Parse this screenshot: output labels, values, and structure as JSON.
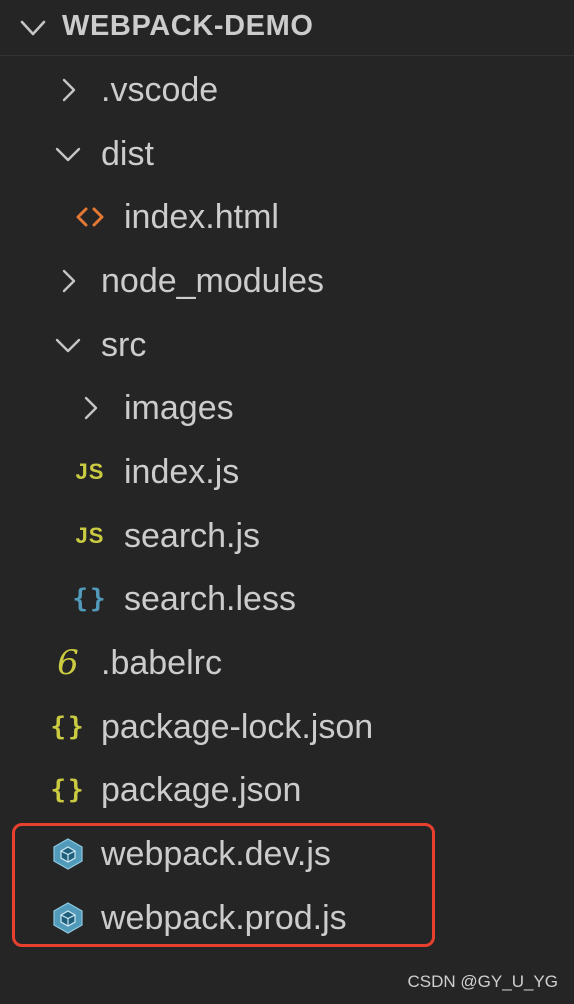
{
  "explorer": {
    "title": "WEBPACK-DEMO",
    "collapse_icon": "chevron-down-icon"
  },
  "tree": [
    {
      "label": ".vscode",
      "type": "folder",
      "expanded": false,
      "level": 0,
      "icon": "chevron-right-icon"
    },
    {
      "label": "dist",
      "type": "folder",
      "expanded": true,
      "level": 0,
      "icon": "chevron-down-icon"
    },
    {
      "label": "index.html",
      "type": "file",
      "level": 1,
      "icon": "html-icon"
    },
    {
      "label": "node_modules",
      "type": "folder",
      "expanded": false,
      "level": 0,
      "icon": "chevron-right-icon"
    },
    {
      "label": "src",
      "type": "folder",
      "expanded": true,
      "level": 0,
      "icon": "chevron-down-icon"
    },
    {
      "label": "images",
      "type": "folder",
      "expanded": false,
      "level": 1,
      "icon": "chevron-right-icon"
    },
    {
      "label": "index.js",
      "type": "file",
      "level": 1,
      "icon": "js-icon"
    },
    {
      "label": "search.js",
      "type": "file",
      "level": 1,
      "icon": "js-icon"
    },
    {
      "label": "search.less",
      "type": "file",
      "level": 1,
      "icon": "less-braces-icon"
    },
    {
      "label": ".babelrc",
      "type": "file",
      "level": 0,
      "icon": "babel-icon"
    },
    {
      "label": "package-lock.json",
      "type": "file",
      "level": 0,
      "icon": "json-braces-icon"
    },
    {
      "label": "package.json",
      "type": "file",
      "level": 0,
      "icon": "json-braces-icon"
    },
    {
      "label": "webpack.dev.js",
      "type": "file",
      "level": 0,
      "icon": "webpack-cube-icon"
    },
    {
      "label": "webpack.prod.js",
      "type": "file",
      "level": 0,
      "icon": "webpack-cube-icon"
    }
  ],
  "icon_glyphs": {
    "js": "JS",
    "braces": "{}",
    "babel": "6"
  },
  "colors": {
    "background": "#252526",
    "text": "#cccccc",
    "html_icon": "#e37933",
    "js_icon": "#cbcb41",
    "less_icon": "#519aba",
    "json_icon": "#cbcb41",
    "webpack_icon": "#519aba",
    "highlight_border": "#e8402f"
  },
  "watermark": "CSDN @GY_U_YG"
}
